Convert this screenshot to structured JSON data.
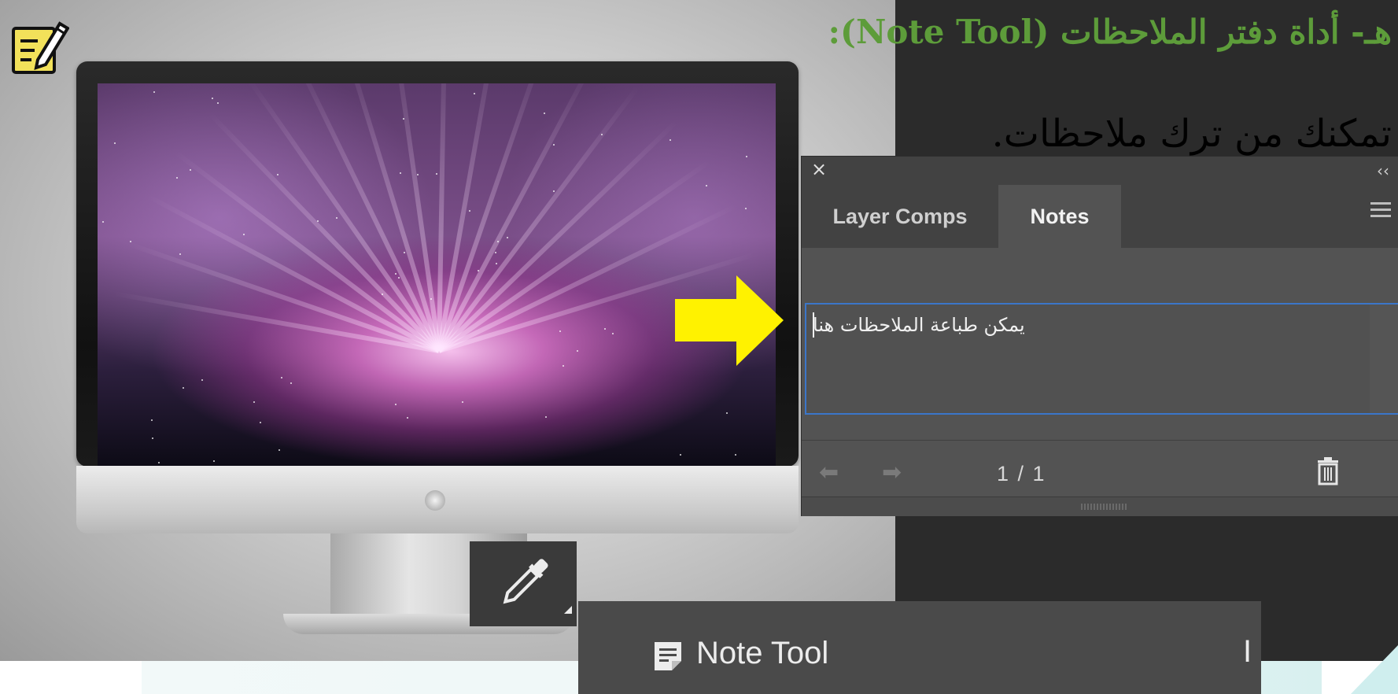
{
  "slide": {
    "title": "هـ- أداة دفتر الملاحظات  (Note Tool):",
    "subtitle": "تمكنك من ترك ملاحظات."
  },
  "notes_panel": {
    "close_glyph": "×",
    "collapse_glyph": "‹‹",
    "tabs": [
      {
        "label": "Layer Comps",
        "active": false
      },
      {
        "label": "Notes",
        "active": true
      }
    ],
    "note_text": "يمكن طباعة الملاحظات هنا",
    "prev_glyph": "⬅",
    "next_glyph": "➡",
    "count_text": "1 / 1",
    "accent_color": "#3b76c9"
  },
  "toolbar_flyout": {
    "tool_label": "Note Tool",
    "shortcut": "I"
  },
  "icons": {
    "edit": "edit-note-icon",
    "eyedropper": "eyedropper-icon",
    "note_tool": "note-icon",
    "delete": "trash-icon",
    "pointer": "yellow-arrow-icon"
  },
  "colors": {
    "title_green": "#5d9c3a",
    "arrow_yellow": "#fff200",
    "panel_bg": "#535353"
  }
}
